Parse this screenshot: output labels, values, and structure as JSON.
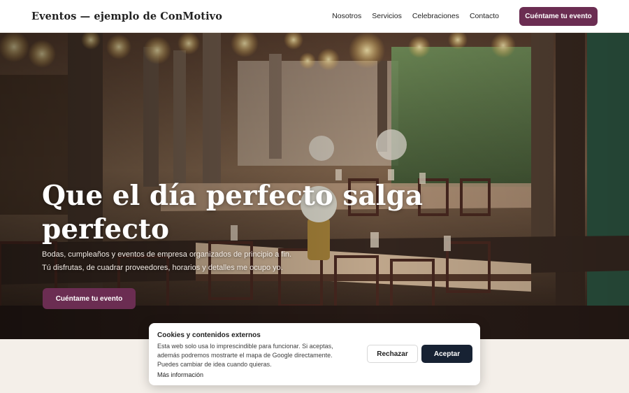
{
  "header": {
    "brand": "Eventos — ejemplo de ConMotivo",
    "nav": [
      "Nosotros",
      "Servicios",
      "Celebraciones",
      "Contacto"
    ],
    "cta_label": "Cuéntame tu evento"
  },
  "hero": {
    "title": "Que el día perfecto salga perfecto",
    "subtitle_line1": "Bodas, cumpleaños y eventos de empresa organizados de principio a fin.",
    "subtitle_line2": "Tú disfrutas, de cuadrar proveedores, horarios y detalles me ocupo yo.",
    "cta_label": "Cuéntame tu evento",
    "image_subject": "banquet-hall-photo"
  },
  "cookie_banner": {
    "title": "Cookies y contenidos externos",
    "text": "Esta web solo usa lo imprescindible para funcionar. Si aceptas, además podremos mostrarte el mapa de Google directamente. Puedes cambiar de idea cuando quieras.",
    "more_link": "Más información",
    "reject_label": "Rechazar",
    "accept_label": "Aceptar"
  },
  "colors": {
    "brand_plum": "#6b2d52",
    "accept_navy": "#172233",
    "page_cream": "#f4efe9"
  }
}
